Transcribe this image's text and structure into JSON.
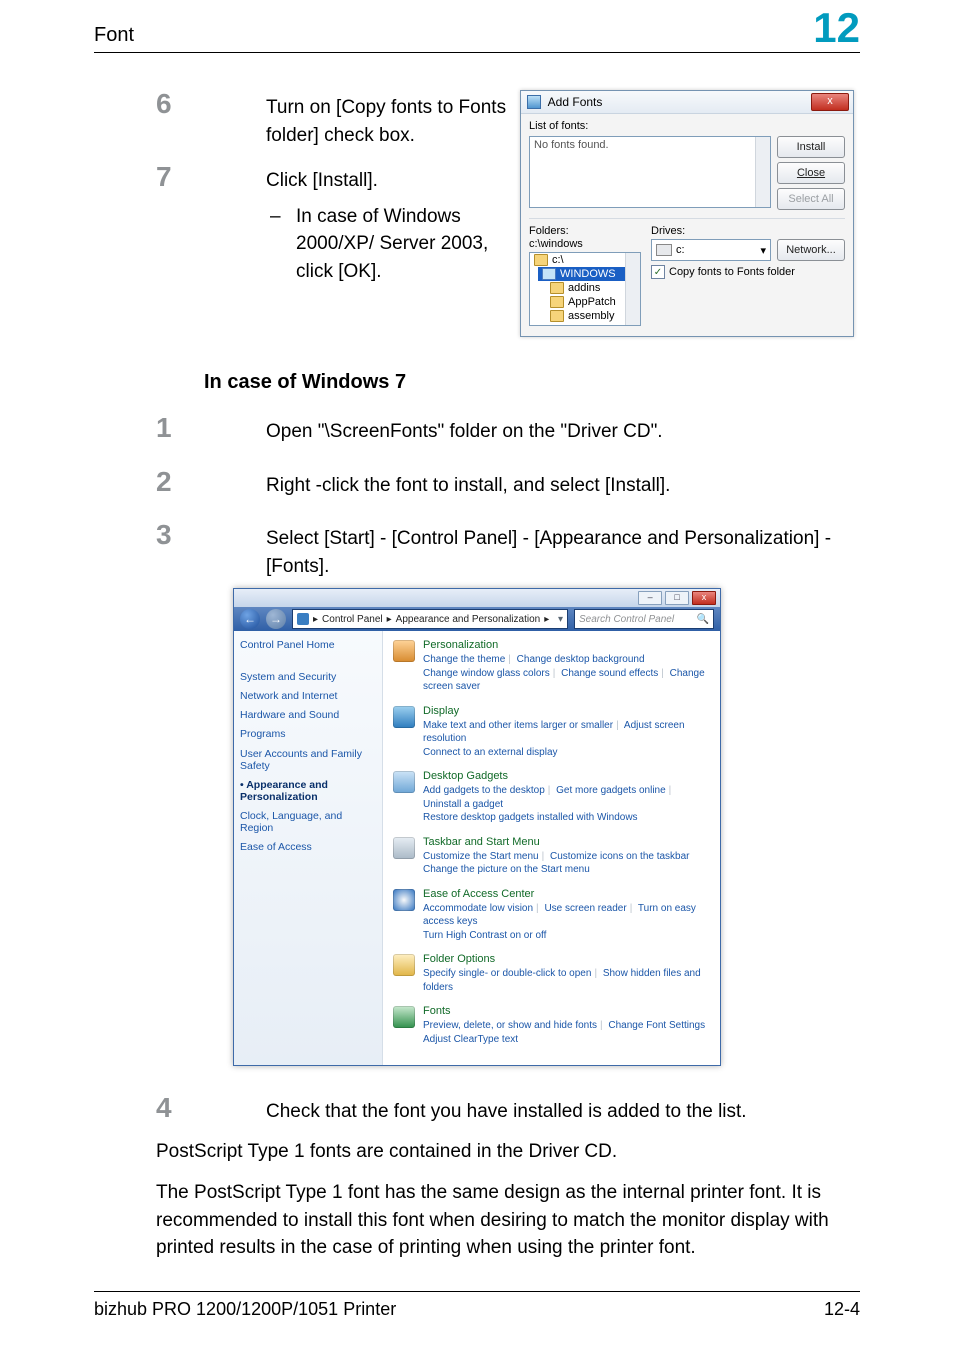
{
  "header": {
    "left": "Font",
    "right": "12"
  },
  "steps_a": {
    "s6": {
      "num": "6",
      "text": "Turn on [Copy fonts to Fonts folder] check box."
    },
    "s7": {
      "num": "7",
      "text": "Click [Install].",
      "sub": "In case of Windows 2000/XP/ Server 2003, click [OK]."
    }
  },
  "dialog": {
    "title": "Add Fonts",
    "close_x": "x",
    "list_label": "List of fonts:",
    "list_content": "No fonts found.",
    "btn_install": "Install",
    "btn_close": "Close",
    "btn_selectall": "Select All",
    "folders_label": "Folders:",
    "folders_path": "c:\\windows",
    "drives_label": "Drives:",
    "drive_value": "c:",
    "btn_network": "Network...",
    "folder_items": {
      "f0": "c:\\",
      "f1": "WINDOWS",
      "f2": "addins",
      "f3": "AppPatch",
      "f4": "assembly"
    },
    "chk_label": "Copy fonts to Fonts folder",
    "chk_mark": "✓",
    "dropdown_caret": "▾"
  },
  "heading_win7": "In case of Windows 7",
  "steps_b": {
    "s1": {
      "num": "1",
      "text": "Open \"\\ScreenFonts\" folder on the \"Driver CD\"."
    },
    "s2": {
      "num": "2",
      "text": "Right -click the font to install, and select [Install]."
    },
    "s3": {
      "num": "3",
      "text": "Select [Start] - [Control Panel] - [Appearance and Personalization] - [Fonts]."
    },
    "s4": {
      "num": "4",
      "text": "Check that the font you have installed is added to the list."
    }
  },
  "cp": {
    "nav_back": "←",
    "nav_fwd": "→",
    "crumb_sep": "▸",
    "crumb1": "Control Panel",
    "crumb2": "Appearance and Personalization",
    "search_placeholder": "Search Control Panel",
    "search_icon": "🔍",
    "refresh_icon_dummy": "▾",
    "sidebar": {
      "home": "Control Panel Home",
      "i1": "System and Security",
      "i2": "Network and Internet",
      "i3": "Hardware and Sound",
      "i4": "Programs",
      "i5": "User Accounts and Family Safety",
      "i6": "Appearance and Personalization",
      "i7": "Clock, Language, and Region",
      "i8": "Ease of Access"
    },
    "cats": {
      "c1": {
        "t": "Personalization",
        "l1": "Change the theme",
        "l2": "Change desktop background",
        "l3": "Change window glass colors",
        "l4": "Change sound effects",
        "l5": "Change screen saver"
      },
      "c2": {
        "t": "Display",
        "l1": "Make text and other items larger or smaller",
        "l2": "Adjust screen resolution",
        "l3": "Connect to an external display"
      },
      "c3": {
        "t": "Desktop Gadgets",
        "l1": "Add gadgets to the desktop",
        "l2": "Get more gadgets online",
        "l3": "Uninstall a gadget",
        "l4": "Restore desktop gadgets installed with Windows"
      },
      "c4": {
        "t": "Taskbar and Start Menu",
        "l1": "Customize the Start menu",
        "l2": "Customize icons on the taskbar",
        "l3": "Change the picture on the Start menu"
      },
      "c5": {
        "t": "Ease of Access Center",
        "l1": "Accommodate low vision",
        "l2": "Use screen reader",
        "l3": "Turn on easy access keys",
        "l4": "Turn High Contrast on or off"
      },
      "c6": {
        "t": "Folder Options",
        "l1": "Specify single- or double-click to open",
        "l2": "Show hidden files and folders"
      },
      "c7": {
        "t": "Fonts",
        "l1": "Preview, delete, or show and hide fonts",
        "l2": "Change Font Settings",
        "l3": "Adjust ClearType text"
      }
    }
  },
  "para1": "PostScript Type 1 fonts are contained in the Driver CD.",
  "para2": "The PostScript Type 1 font has the same design as the internal printer font. It is recommended to install this font when desiring to match the monitor display with printed results in the case of printing when using the printer font.",
  "footer": {
    "left": "bizhub PRO 1200/1200P/1051 Printer",
    "right": "12-4"
  }
}
